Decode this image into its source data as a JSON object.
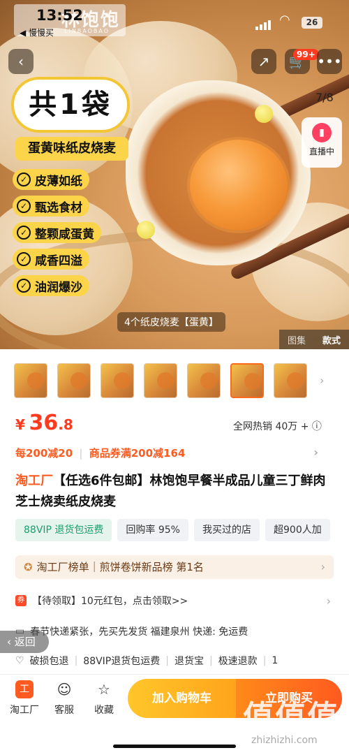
{
  "status_bar": {
    "time": "13:52",
    "back_app": "◀ 慢慢买",
    "battery": "26"
  },
  "hero": {
    "brand_text": "林饱饱",
    "brand_sub": "LINBAOBAO",
    "promo_title": "共1袋",
    "promo_subtitle": "蛋黄味纸皮烧麦",
    "features": [
      "皮薄如纸",
      "甄选食材",
      "整颗咸蛋黄",
      "咸香四溢",
      "油润爆沙"
    ],
    "counter": "7/8",
    "live_label": "直播中",
    "caption": "4个纸皮烧麦【蛋黄】",
    "view_tabs": [
      "图集",
      "款式"
    ],
    "cart_badge": "99+"
  },
  "product": {
    "price_symbol": "¥",
    "price_int": "36",
    "price_dec": ".8",
    "sales": "全网热销 40万 + ⓘ",
    "discount_1": "每200减20",
    "discount_2": "商品券满200减164",
    "brand": "淘工厂",
    "title": "【任选6件包邮】林饱饱早餐半成品儿童三丁鲜肉芝士烧卖纸皮烧麦",
    "tags": [
      "88VIP 退货包运费",
      "回购率 95%",
      "我买过的店",
      "超900人加"
    ],
    "rank": "淘工厂榜单｜煎饼卷饼新品榜 第1名",
    "coupon": "【待领取】10元红包，点击领取>>",
    "shipping": "春节快递紧张，先买先发货  福建泉州  快递: 免运费",
    "services": [
      "破损包退",
      "88VIP退货包运费",
      "退货宝",
      "极速退款",
      "1"
    ],
    "float_back": "‹ 返回"
  },
  "bottom_bar": {
    "items": [
      {
        "label": "淘工厂",
        "icon": "taogongchang-icon"
      },
      {
        "label": "客服",
        "icon": "customer-service-icon"
      },
      {
        "label": "收藏",
        "icon": "star-icon"
      }
    ],
    "add_to_cart": "加入购物车",
    "buy_now": "立即购买"
  },
  "watermark": {
    "text": "值值值",
    "url": "zhizhizhi.com"
  },
  "colors": {
    "accent": "#ff5a1f",
    "price": "#ff3b1f",
    "vip": "#18a06a",
    "cart_btn": "#ffb21f"
  }
}
